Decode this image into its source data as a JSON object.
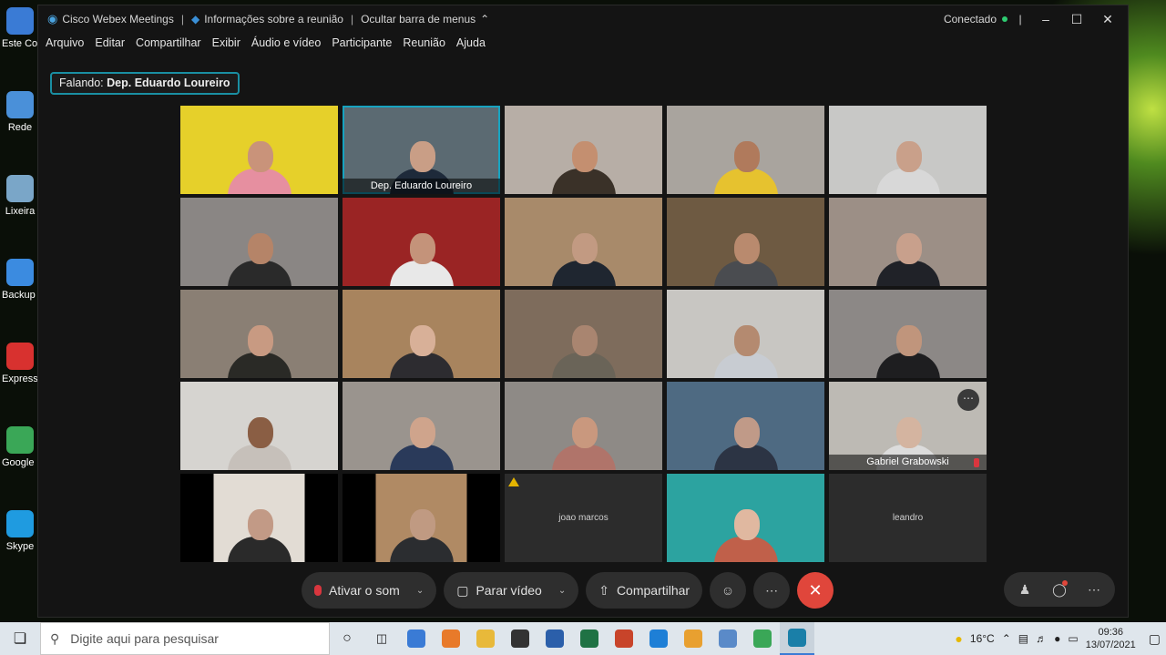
{
  "desktop": {
    "icons": [
      {
        "label": "Este Computador",
        "color": "#3a7bd5"
      },
      {
        "label": "Rede",
        "color": "#4a90d9"
      },
      {
        "label": "Lixeira",
        "color": "#7aa6c8"
      },
      {
        "label": "Backup and Sync from Google",
        "color": "#3b8be0"
      },
      {
        "label": "ExpressVPN",
        "color": "#d8312f"
      },
      {
        "label": "Google Chrome",
        "color": "#3aa757"
      },
      {
        "label": "Skype",
        "color": "#1f9be0"
      }
    ]
  },
  "window": {
    "app_title": "Cisco Webex Meetings",
    "meeting_info": "Informações sobre a reunião",
    "hide_menu": "Ocultar barra de menus",
    "status": "Conectado",
    "menu": [
      "Arquivo",
      "Editar",
      "Compartilhar",
      "Exibir",
      "Áudio e vídeo",
      "Participante",
      "Reunião",
      "Ajuda"
    ],
    "speaking_prefix": "Falando:",
    "speaking_name": "Dep. Eduardo Loureiro"
  },
  "tiles": [
    {
      "bg": "#e6d02a",
      "skin": "#c9937a",
      "shirt": "#e68fa0",
      "label": ""
    },
    {
      "bg": "#5b6a72",
      "skin": "#c99e86",
      "shirt": "#1e2a3a",
      "label": "Dep. Eduardo Loureiro",
      "active": true
    },
    {
      "bg": "#b7aea6",
      "skin": "#c48f70",
      "shirt": "#3a3128",
      "label": ""
    },
    {
      "bg": "#a9a49e",
      "skin": "#b07a5c",
      "shirt": "#e6c22f",
      "label": ""
    },
    {
      "bg": "#c8c8c6",
      "skin": "#c9a08a",
      "shirt": "#d8d8d8",
      "label": ""
    },
    {
      "bg": "#8a8684",
      "skin": "#b58468",
      "shirt": "#2a2a2a",
      "label": ""
    },
    {
      "bg": "#9a2424",
      "skin": "#c4937a",
      "shirt": "#e8e8e8",
      "label": ""
    },
    {
      "bg": "#a88a6a",
      "skin": "#c29a82",
      "shirt": "#1f2630",
      "label": ""
    },
    {
      "bg": "#6e5a42",
      "skin": "#b98a6e",
      "shirt": "#4a4c50",
      "label": ""
    },
    {
      "bg": "#9c8f86",
      "skin": "#c8a08c",
      "shirt": "#202228",
      "label": ""
    },
    {
      "bg": "#8a7f74",
      "skin": "#c89a82",
      "shirt": "#2a2a26",
      "label": ""
    },
    {
      "bg": "#a8845e",
      "skin": "#d8b098",
      "shirt": "#2d2c30",
      "label": ""
    },
    {
      "bg": "#7e6c5c",
      "skin": "#a98570",
      "shirt": "#6a6458",
      "label": ""
    },
    {
      "bg": "#c8c6c2",
      "skin": "#b48a70",
      "shirt": "#c8ccd2",
      "label": ""
    },
    {
      "bg": "#8c8886",
      "skin": "#c0957c",
      "shirt": "#1e1e20",
      "label": ""
    },
    {
      "bg": "#d6d4d0",
      "skin": "#8a5e44",
      "shirt": "#c6c0ba",
      "label": ""
    },
    {
      "bg": "#9a948e",
      "skin": "#cfa48c",
      "shirt": "#2a3a5a",
      "label": ""
    },
    {
      "bg": "#8e8a86",
      "skin": "#c9987e",
      "shirt": "#b0746a",
      "label": ""
    },
    {
      "bg": "#4e6a82",
      "skin": "#c09a88",
      "shirt": "#2c3444",
      "label": ""
    },
    {
      "bg": "#bdbab4",
      "skin": "#d4b4a0",
      "shirt": "#dcdcdc",
      "label": "Gabriel Grabowski",
      "more": true,
      "mic_off": true
    },
    {
      "bg": "#e2dcd4",
      "skin": "#c29a86",
      "shirt": "#2a2a2a",
      "label": "",
      "letterbox": true
    },
    {
      "bg": "#b08a64",
      "skin": "#c09a82",
      "shirt": "#2b2d30",
      "label": "",
      "letterbox": true
    },
    {
      "blank": true,
      "center": "joao marcos",
      "warn": true
    },
    {
      "bg": "#2ca3a0",
      "skin": "#e0b8a0",
      "shirt": "#c0604a",
      "label": ""
    },
    {
      "blank": true,
      "center": "leandro"
    }
  ],
  "controls": {
    "mute": "Ativar o som",
    "video": "Parar vídeo",
    "share": "Compartilhar"
  },
  "taskbar": {
    "search_placeholder": "Digite aqui para pesquisar",
    "apps": [
      "#3a7bd5",
      "#e87a2a",
      "#e8b93a",
      "#333333",
      "#2b5faa",
      "#1f7244",
      "#c8442a",
      "#1e7fd6",
      "#e8a030",
      "#5a8ac8",
      "#3aa757",
      "#1a7fa8"
    ],
    "weather": "16°C",
    "time": "09:36",
    "date": "13/07/2021"
  }
}
